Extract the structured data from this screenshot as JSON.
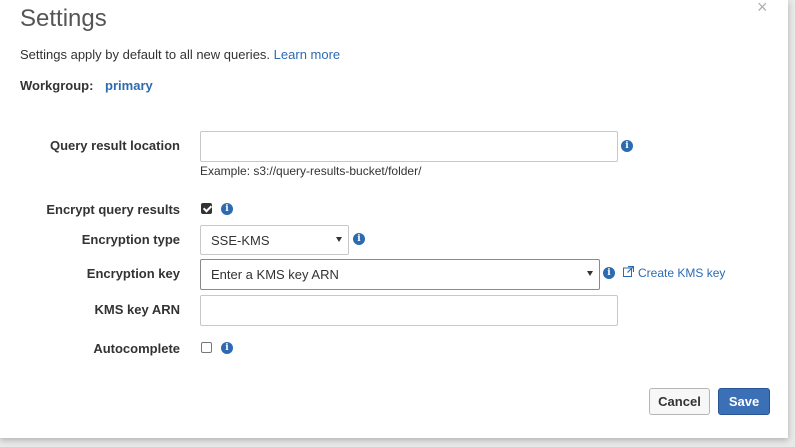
{
  "dialog": {
    "title": "Settings",
    "close_icon": "×",
    "subtitle": "Settings apply by default to all new queries.",
    "learn_more": "Learn more",
    "workgroup_label": "Workgroup:",
    "workgroup_value": "primary"
  },
  "form": {
    "query_result_location": {
      "label": "Query result location",
      "value": "",
      "example": "Example: s3://query-results-bucket/folder/"
    },
    "encrypt_query_results": {
      "label": "Encrypt query results",
      "checked": true
    },
    "encryption_type": {
      "label": "Encryption type",
      "selected": "SSE-KMS"
    },
    "encryption_key": {
      "label": "Encryption key",
      "selected": "Enter a KMS key ARN",
      "create_link": "Create KMS key"
    },
    "kms_key_arn": {
      "label": "KMS key ARN",
      "value": ""
    },
    "autocomplete": {
      "label": "Autocomplete",
      "checked": false
    }
  },
  "buttons": {
    "cancel": "Cancel",
    "save": "Save"
  },
  "colors": {
    "accent": "#2c6bb2",
    "save_button": "#3b6fb6"
  }
}
